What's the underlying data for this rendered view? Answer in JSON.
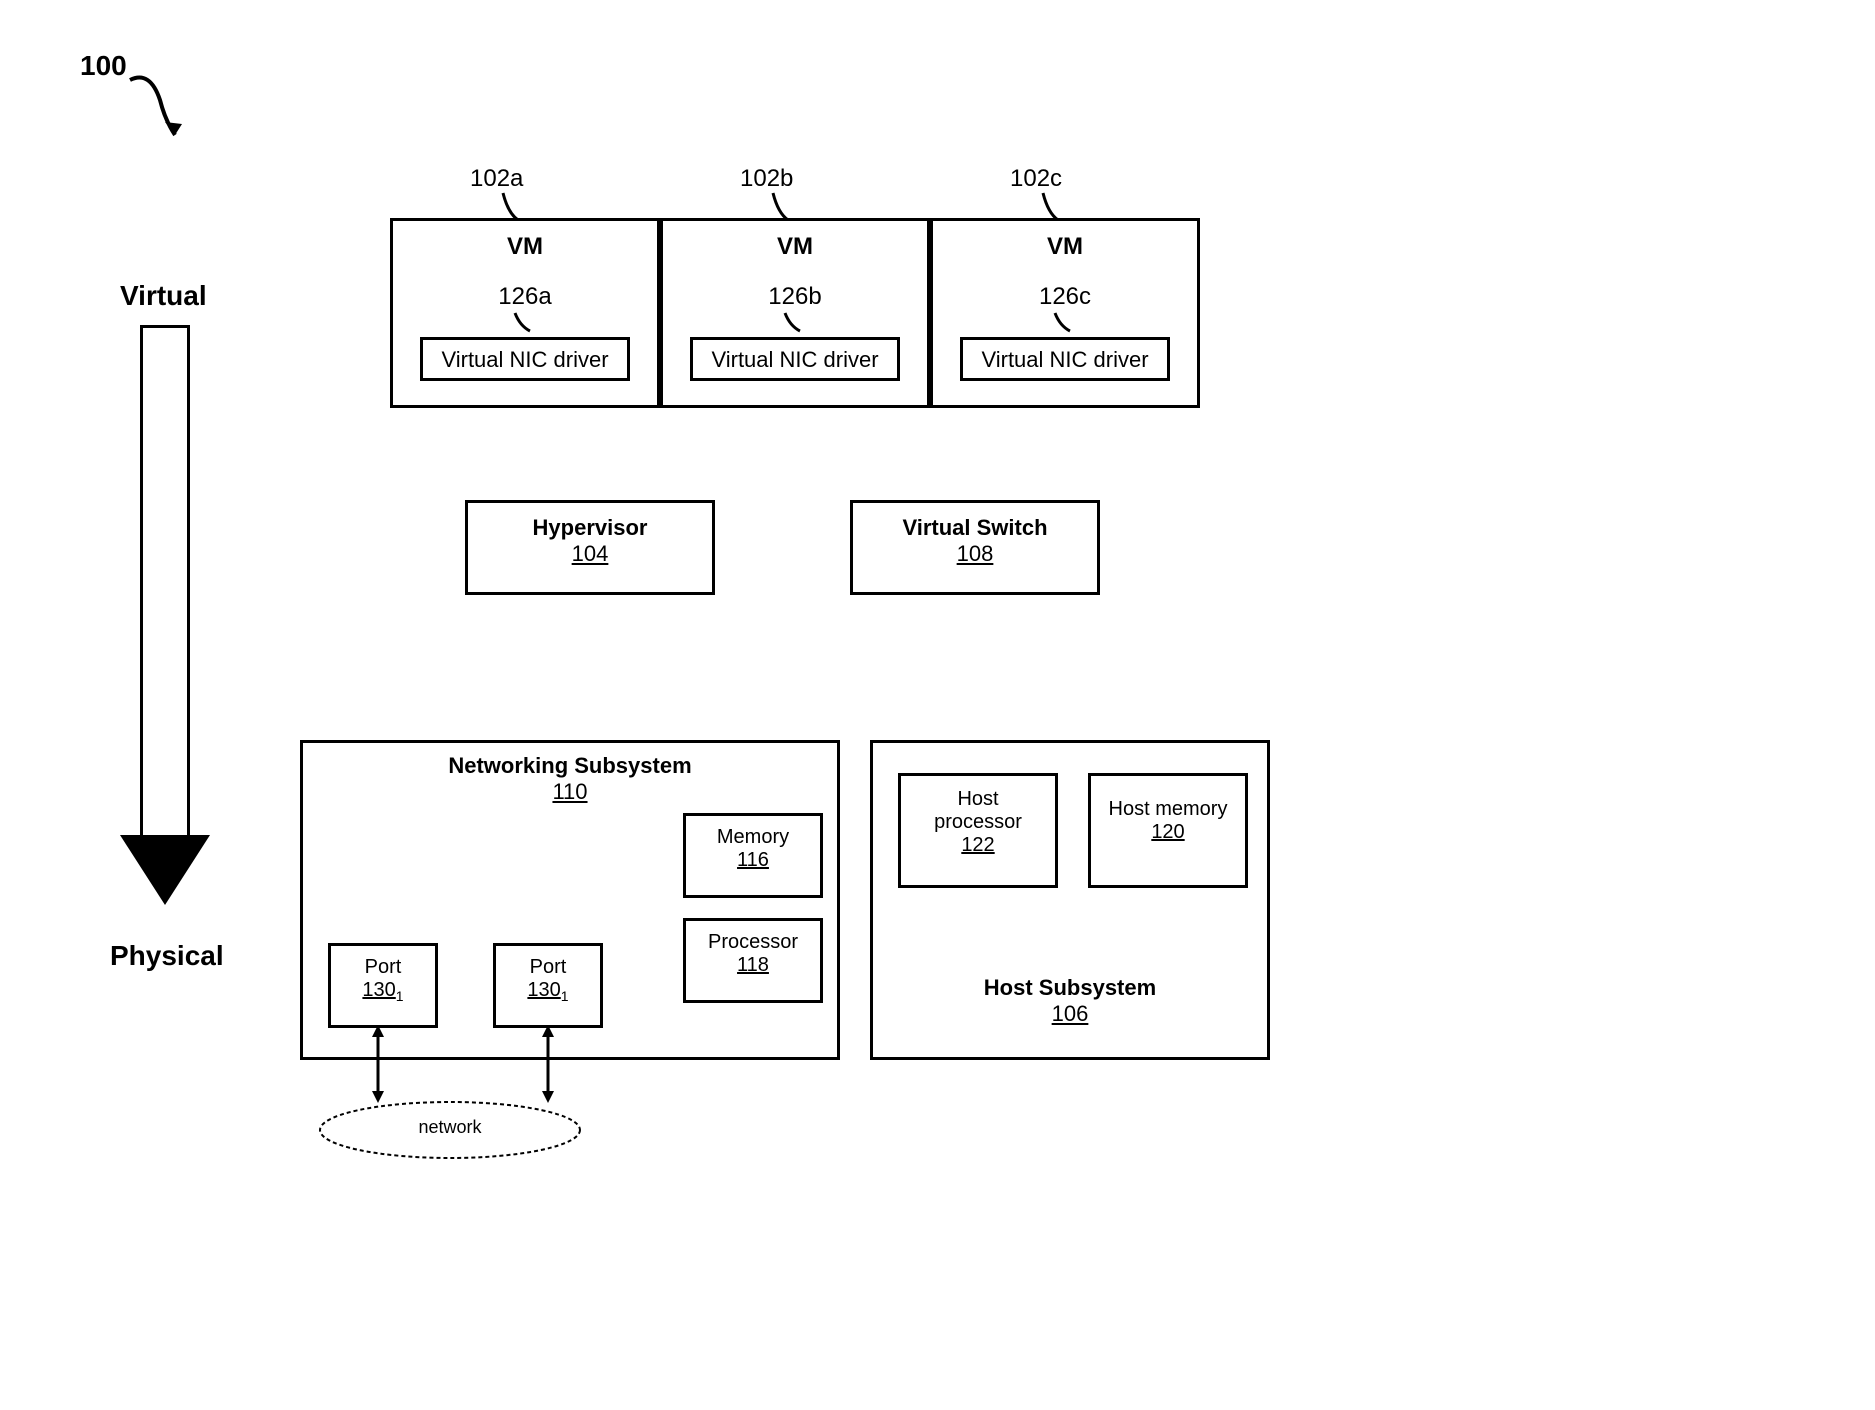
{
  "figure_label": "100",
  "axis": {
    "top": "Virtual",
    "bottom": "Physical"
  },
  "vms": {
    "a": {
      "ref": "102a",
      "title": "VM",
      "nic_ref": "126a",
      "nic_label": "Virtual NIC driver"
    },
    "b": {
      "ref": "102b",
      "title": "VM",
      "nic_ref": "126b",
      "nic_label": "Virtual NIC driver"
    },
    "c": {
      "ref": "102c",
      "title": "VM",
      "nic_ref": "126c",
      "nic_label": "Virtual NIC driver"
    }
  },
  "hypervisor": {
    "title": "Hypervisor",
    "ref": "104"
  },
  "vswitch": {
    "title": "Virtual Switch",
    "ref": "108"
  },
  "net_sub": {
    "title": "Networking Subsystem",
    "ref": "110",
    "memory": {
      "title": "Memory",
      "ref": "116"
    },
    "processor": {
      "title": "Processor",
      "ref": "118"
    },
    "port_a": {
      "title": "Port",
      "ref": "130",
      "sub": "1"
    },
    "port_b": {
      "title": "Port",
      "ref": "130",
      "sub": "1"
    }
  },
  "host_sub": {
    "title": "Host Subsystem",
    "ref": "106",
    "proc": {
      "title": "Host\nprocessor",
      "ref": "122"
    },
    "mem": {
      "title": "Host memory",
      "ref": "120"
    }
  },
  "network": {
    "label": "network"
  }
}
